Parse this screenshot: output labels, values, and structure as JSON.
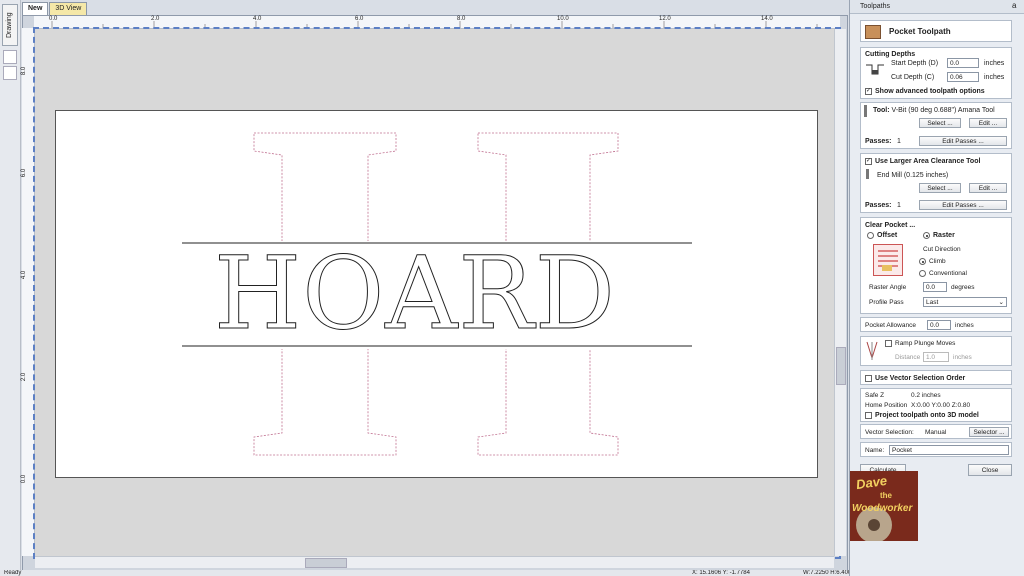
{
  "app": {
    "left_tab_label": "Drawing",
    "tabs": [
      {
        "label": "New"
      },
      {
        "label": "3D View"
      }
    ],
    "status": {
      "left": "Ready",
      "coords": "X: 15.1606 Y: -1.7784",
      "right": "W:7.2250 H:6.4000 S:4"
    }
  },
  "ruler": {
    "h_ticks": [
      "0.0",
      "2.0",
      "4.0",
      "6.0",
      "8.0",
      "10.0",
      "12.0",
      "14.0"
    ],
    "v_ticks": [
      "8.0",
      "6.0",
      "4.0",
      "2.0",
      "0.0"
    ]
  },
  "design": {
    "word": "HOARD",
    "monogram": "H"
  },
  "panel": {
    "header": "Toolpaths",
    "title": "Pocket Toolpath",
    "cutting_depths": {
      "heading": "Cutting Depths",
      "start_label": "Start Depth (D)",
      "start_value": "0.0",
      "start_unit": "inches",
      "cut_label": "Cut Depth (C)",
      "cut_value": "0.06",
      "cut_unit": "inches",
      "advanced_label": "Show advanced toolpath options"
    },
    "tool": {
      "label": "Tool:",
      "name": "V-Bit (90 deg 0.688\") Amana Tool",
      "select": "Select ...",
      "edit": "Edit ...",
      "passes_label": "Passes:",
      "passes_value": "1",
      "edit_passes": "Edit Passes ..."
    },
    "clearance": {
      "label": "Use Larger Area Clearance Tool",
      "name": "End Mill (0.125 inches)",
      "select": "Select ...",
      "edit": "Edit ...",
      "passes_label": "Passes:",
      "passes_value": "1",
      "edit_passes": "Edit Passes ..."
    },
    "clear_pocket": {
      "heading": "Clear Pocket ...",
      "offset": "Offset",
      "raster": "Raster",
      "cut_direction": "Cut Direction",
      "climb": "Climb",
      "conventional": "Conventional",
      "raster_angle_label": "Raster Angle",
      "raster_angle_value": "0.0",
      "raster_angle_unit": "degrees",
      "profile_pass_label": "Profile Pass",
      "profile_pass_value": "Last"
    },
    "pocket_allowance": {
      "label": "Pocket Allowance",
      "value": "0.0",
      "unit": "inches"
    },
    "ramp": {
      "label": "Ramp Plunge Moves",
      "distance_label": "Distance",
      "distance_value": "1.0",
      "distance_unit": "inches"
    },
    "vector_order_label": "Use Vector Selection Order",
    "safe_z_label": "Safe Z",
    "safe_z_value": "0.2 inches",
    "home_label": "Home Position",
    "home_value": "X:0.00 Y:0.00 Z:0.80",
    "project_label": "Project toolpath onto 3D model",
    "vector_selection_label": "Vector Selection:",
    "vector_selection_value": "Manual",
    "selector_btn": "Selector ...",
    "name_label": "Name:",
    "name_value": "Pocket",
    "calculate": "Calculate",
    "close": "Close",
    "watermark_line1": "Dave",
    "watermark_line2": "the",
    "watermark_line3": "Woodworker"
  }
}
